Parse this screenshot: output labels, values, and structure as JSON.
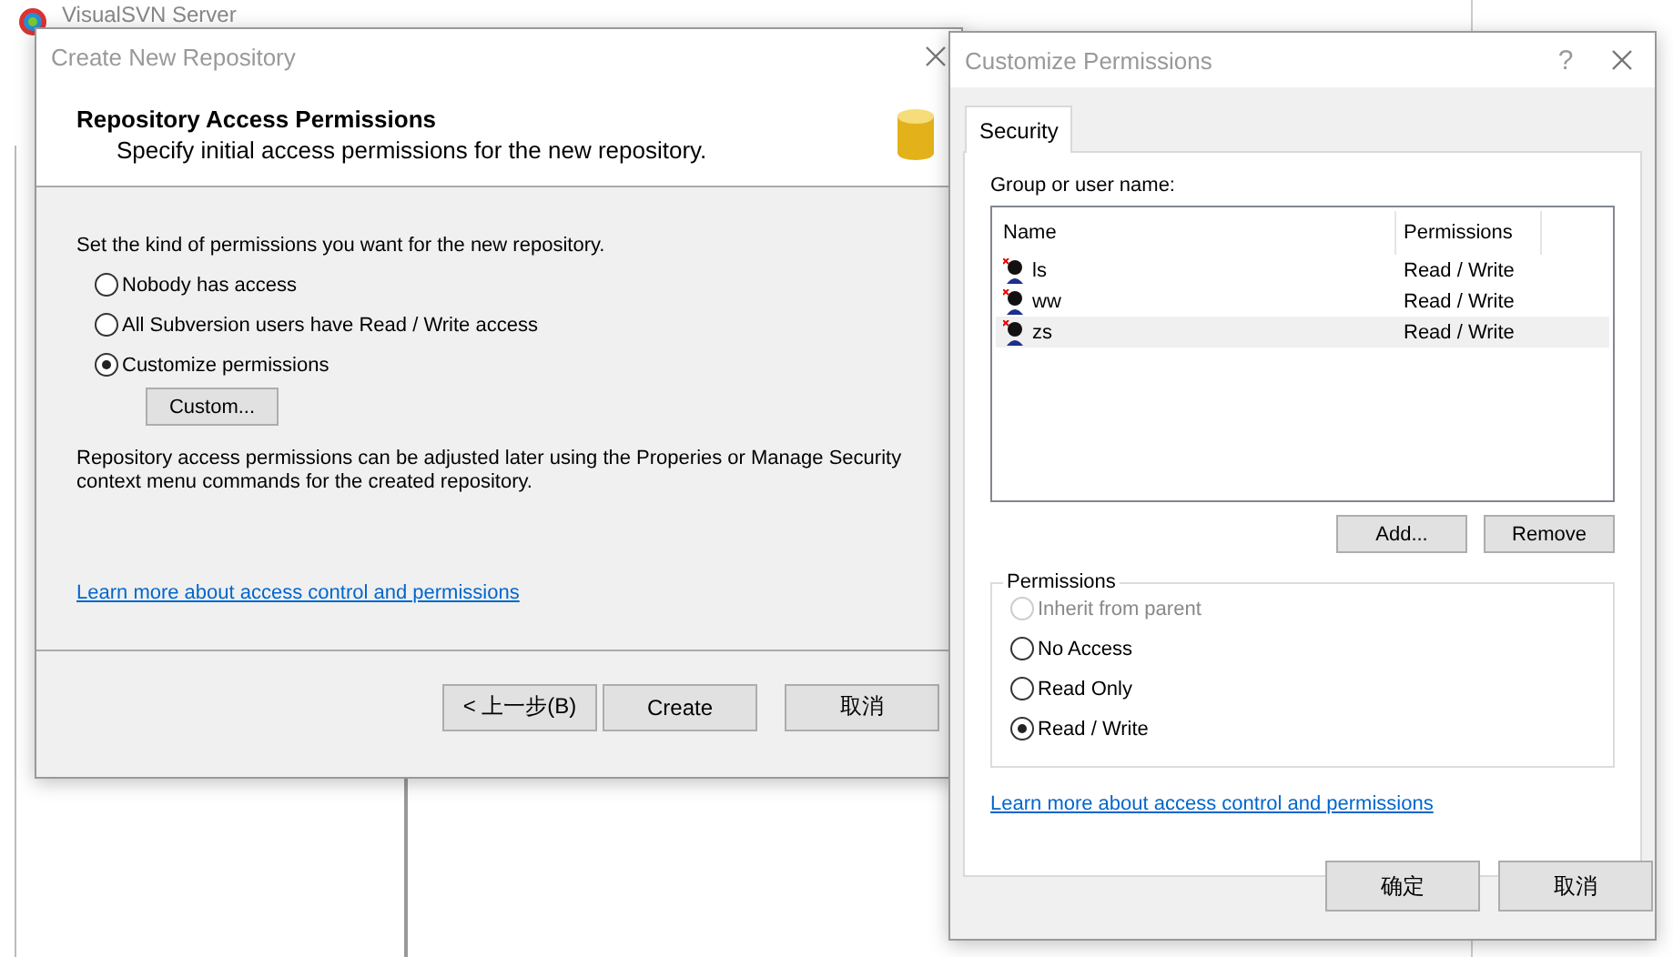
{
  "background_window": {
    "title": "VisualSVN Server"
  },
  "wizard": {
    "title": "Create New Repository",
    "heading": "Repository Access Permissions",
    "subheading": "Specify initial access permissions for the new repository.",
    "prompt": "Set the kind of permissions you want for the new repository.",
    "options": [
      {
        "label": "Nobody has access",
        "selected": false
      },
      {
        "label": "All Subversion users have Read / Write access",
        "selected": false
      },
      {
        "label": "Customize permissions",
        "selected": true
      }
    ],
    "custom_button": "Custom...",
    "note": "Repository access permissions can be adjusted later using the Properies or Manage Security context menu commands for the created repository.",
    "link": "Learn more about access control and permissions",
    "buttons": [
      "< 上一步(B)",
      "Create",
      "取消"
    ]
  },
  "permissions_dialog": {
    "title": "Customize Permissions",
    "help": "?",
    "tabs": [
      {
        "label": "Security",
        "selected": true
      }
    ],
    "list_label": "Group or user name:",
    "columns": [
      "Name",
      "Permissions"
    ],
    "rows": [
      {
        "name": "ls",
        "permissions": "Read / Write",
        "selected": false
      },
      {
        "name": "ww",
        "permissions": "Read / Write",
        "selected": false
      },
      {
        "name": "zs",
        "permissions": "Read / Write",
        "selected": true
      }
    ],
    "list_buttons": [
      "Add...",
      "Remove"
    ],
    "group_title": "Permissions",
    "options": [
      {
        "label": "Inherit from parent",
        "selected": false,
        "disabled": true
      },
      {
        "label": "No Access",
        "selected": false,
        "disabled": false
      },
      {
        "label": "Read Only",
        "selected": false,
        "disabled": false
      },
      {
        "label": "Read / Write",
        "selected": true,
        "disabled": false
      }
    ],
    "link": "Learn more about access control and permissions",
    "buttons": [
      "确定",
      "取消"
    ]
  }
}
